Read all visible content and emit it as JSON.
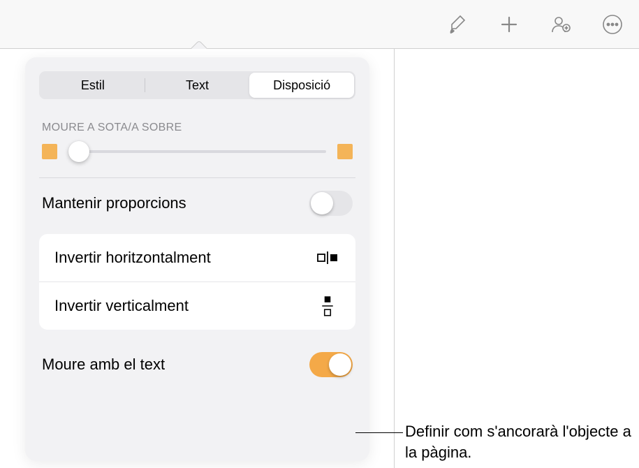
{
  "toolbar": {
    "icons": [
      "brush",
      "add",
      "collaborate",
      "more"
    ]
  },
  "tabs": {
    "items": [
      {
        "label": "Estil",
        "active": false
      },
      {
        "label": "Text",
        "active": false
      },
      {
        "label": "Disposició",
        "active": true
      }
    ]
  },
  "section": {
    "move_header": "MOURE A SOTA/A SOBRE"
  },
  "slider": {
    "value": 4,
    "endpoint_color": "#f4b458"
  },
  "rows": {
    "constrain_label": "Mantenir proporcions",
    "constrain_on": false,
    "move_with_text_label": "Moure amb el text",
    "move_with_text_on": true
  },
  "flip": {
    "horizontal_label": "Invertir horitzontalment",
    "vertical_label": "Invertir verticalment"
  },
  "callout": {
    "text": "Definir com s'ancorarà l'objecte a la pàgina."
  }
}
